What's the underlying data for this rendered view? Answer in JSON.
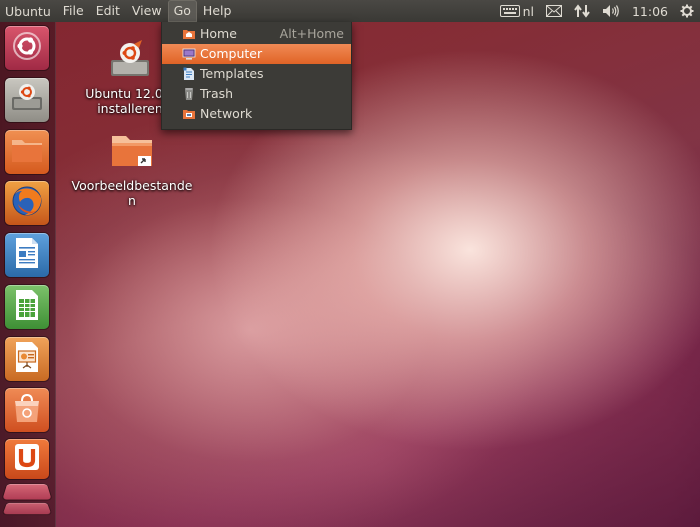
{
  "top_panel": {
    "app_title": "Ubuntu",
    "menu": [
      "File",
      "Edit",
      "View",
      "Go",
      "Help"
    ],
    "active_menu": "Go",
    "keyboard_layout": "nl",
    "clock": "11:06",
    "icons": [
      "keyboard-icon",
      "mail-icon",
      "network-icon",
      "volume-icon",
      "power-gear-icon"
    ]
  },
  "go_menu": {
    "items": [
      {
        "label": "Home",
        "accel": "Alt+Home",
        "icon": "home-folder-icon"
      },
      {
        "label": "Computer",
        "accel": "",
        "icon": "computer-icon",
        "selected": true
      },
      {
        "label": "Templates",
        "accel": "",
        "icon": "templates-icon"
      },
      {
        "label": "Trash",
        "accel": "",
        "icon": "trash-icon"
      },
      {
        "label": "Network",
        "accel": "",
        "icon": "network-folder-icon"
      }
    ]
  },
  "desktop_icons": {
    "installer": {
      "line1": "Ubuntu 12.04.",
      "line2": "installeren"
    },
    "sample": {
      "line1": "Voorbeeldbestande",
      "line2": "n"
    }
  },
  "launcher": {
    "items": [
      "dash-home",
      "ubuntu-installer",
      "files",
      "firefox",
      "libreoffice-writer",
      "libreoffice-calc",
      "libreoffice-impress",
      "ubuntu-software-center",
      "ubuntu-one",
      "workspace-switcher",
      "trash"
    ]
  },
  "colors": {
    "accent": "#e66a30",
    "panel": "#3c3b37",
    "menu_text": "#dfdbd2"
  }
}
